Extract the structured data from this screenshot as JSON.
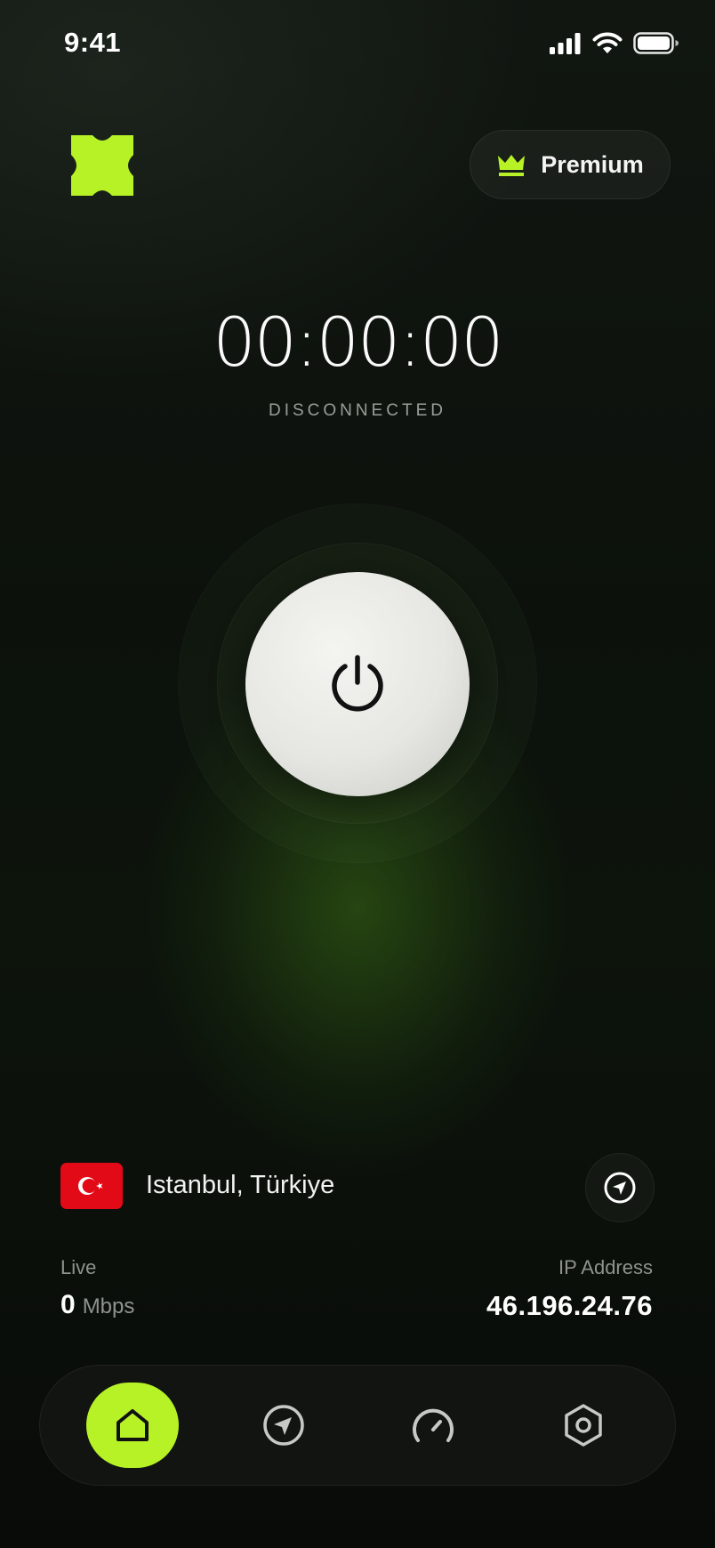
{
  "status_bar": {
    "time": "9:41"
  },
  "header": {
    "premium_label": "Premium"
  },
  "connection": {
    "timer": "00:00:00",
    "status": "DISCONNECTED"
  },
  "location": {
    "name": "Istanbul, Türkiye",
    "flag": "turkey-flag"
  },
  "stats": {
    "live_label": "Live",
    "speed_value": "0",
    "speed_unit": "Mbps",
    "ip_label": "IP Address",
    "ip_value": "46.196.24.76"
  },
  "nav": {
    "items": [
      {
        "icon": "home-icon",
        "active": true
      },
      {
        "icon": "navigation-icon",
        "active": false
      },
      {
        "icon": "speedometer-icon",
        "active": false
      },
      {
        "icon": "settings-icon",
        "active": false
      }
    ]
  },
  "colors": {
    "accent": "#b7f227",
    "background": "#0c110c",
    "flag_red": "#e30a17"
  }
}
